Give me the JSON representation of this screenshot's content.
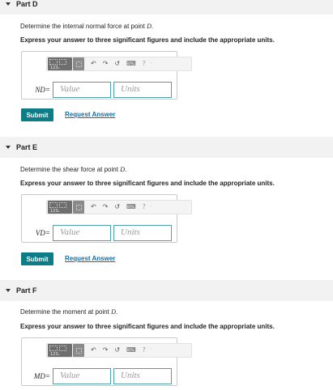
{
  "parts": [
    {
      "title": "Part D",
      "prompt_text": "Determine the internal normal force at point ",
      "point": "D",
      "prompt_end": ".",
      "instruction": "Express your answer to three significant figures and include the appropriate units.",
      "field_label": "ND=",
      "value_placeholder": "Value",
      "units_placeholder": "Units"
    },
    {
      "title": "Part E",
      "prompt_text": "Determine the shear force at point ",
      "point": "D",
      "prompt_end": ".",
      "instruction": "Express your answer to three significant figures and include the appropriate units.",
      "field_label": "VD=",
      "value_placeholder": "Value",
      "units_placeholder": "Units"
    },
    {
      "title": "Part F",
      "prompt_text": "Determine the moment at point ",
      "point": "D",
      "prompt_end": ".",
      "instruction": "Express your answer to three significant figures and include the appropriate units.",
      "field_label": "MD=",
      "value_placeholder": "Value",
      "units_placeholder": "Units"
    }
  ],
  "toolbar": {
    "templates_icon_text": "123ₑ",
    "undo_icon": "↶",
    "redo_icon": "↷",
    "reset_icon": "↺",
    "keyboard_icon": "⌨",
    "help_icon": "?",
    "more_icon": "·"
  },
  "buttons": {
    "submit_label": "Submit",
    "request_answer_label": "Request Answer"
  },
  "colors": {
    "accent": "#0e7c86",
    "link": "#0e6ea8",
    "field_border": "#4aa3a8",
    "header_bg": "#f2f2f2"
  }
}
